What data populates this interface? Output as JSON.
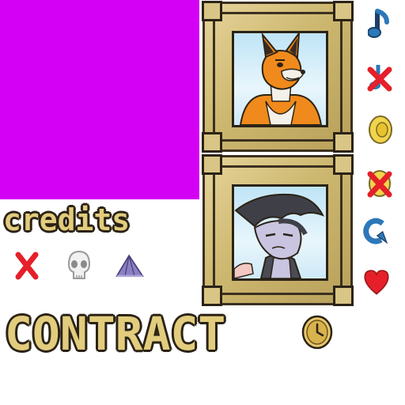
{
  "credits_label": "credits",
  "contract_label": "CONTRACT",
  "colors": {
    "placeholder": "#d400f5",
    "frame_gold": "#d9c585",
    "frame_outline": "#2b2316",
    "icon_blue": "#2c78b8",
    "icon_red": "#e5202a",
    "icon_yellow": "#f2d44b"
  },
  "icons": {
    "sidebar": [
      "music-note-icon",
      "music-muted-icon",
      "sound-icon",
      "sound-muted-icon",
      "refresh-icon",
      "heart-icon"
    ],
    "credits_row": [
      "close-icon",
      "skull-icon",
      "tent-icon"
    ],
    "contract_row": [
      "clock-icon"
    ]
  }
}
